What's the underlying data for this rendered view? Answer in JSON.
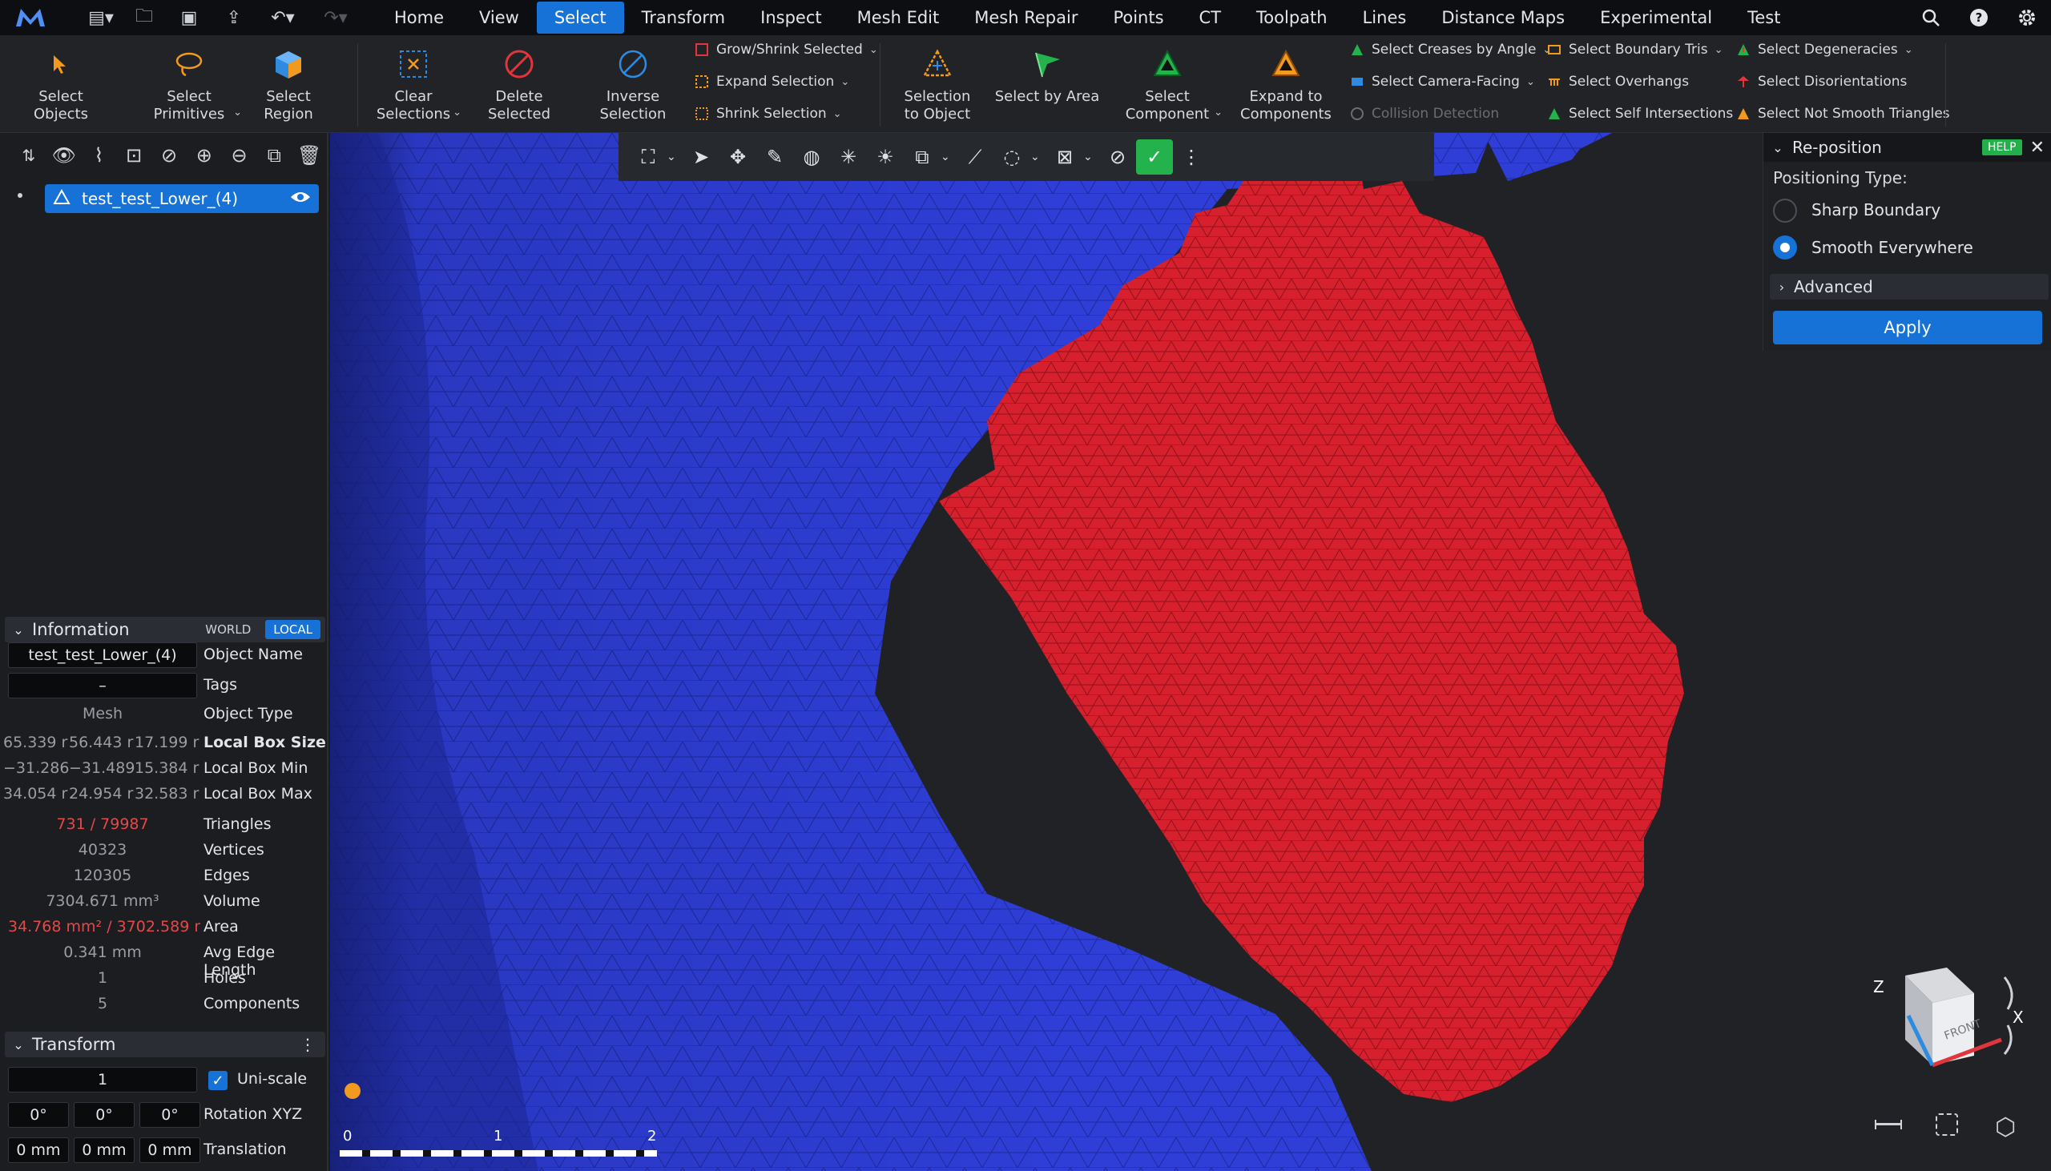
{
  "menu": {
    "tabs": [
      "Home",
      "View",
      "Select",
      "Transform",
      "Inspect",
      "Mesh Edit",
      "Mesh Repair",
      "Points",
      "CT",
      "Toolpath",
      "Lines",
      "Distance Maps",
      "Experimental",
      "Test"
    ],
    "active": "Select"
  },
  "ribbon": {
    "select_objects": "Select Objects",
    "select_primitives": "Select\nPrimitives",
    "select_region": "Select Region",
    "clear_selections": "Clear\nSelections",
    "delete_selected": "Delete Selected",
    "inverse_selection": "Inverse\nSelection",
    "grow_shrink": "Grow/Shrink Selected",
    "expand_selection": "Expand Selection",
    "shrink_selection": "Shrink Selection",
    "selection_to_object": "Selection\nto Object",
    "select_by_area": "Select by Area",
    "select_component": "Select\nComponent",
    "expand_to_components": "Expand to\nComponents",
    "select_creases": "Select Creases by Angle",
    "select_camera_facing": "Select Camera-Facing",
    "collision_detection": "Collision Detection",
    "select_boundary_tris": "Select Boundary Tris",
    "select_overhangs": "Select Overhangs",
    "select_self_intersections": "Select Self Intersections",
    "select_degeneracies": "Select Degeneracies",
    "select_disorientations": "Select Disorientations",
    "select_not_smooth": "Select Not Smooth Triangles"
  },
  "tree": {
    "object_name": "test_test_Lower_(4)"
  },
  "information": {
    "title": "Information",
    "world": "WORLD",
    "local": "LOCAL",
    "object_name_value": "test_test_Lower_(4)",
    "object_name_label": "Object Name",
    "tags_value": "–",
    "tags_label": "Tags",
    "object_type_value": "Mesh",
    "object_type_label": "Object Type",
    "box_size": [
      "65.339 r",
      "56.443 r",
      "17.199 r"
    ],
    "box_size_label": "Local Box Size",
    "box_min": [
      "−31.286",
      "−31.489",
      "15.384 r"
    ],
    "box_min_label": "Local Box Min",
    "box_max": [
      "34.054 r",
      "24.954 r",
      "32.583 r"
    ],
    "box_max_label": "Local Box Max",
    "triangles_value": "731 / 79987",
    "triangles_label": "Triangles",
    "vertices_value": "40323",
    "vertices_label": "Vertices",
    "edges_value": "120305",
    "edges_label": "Edges",
    "volume_value": "7304.671 mm³",
    "volume_label": "Volume",
    "area_value": "34.768 mm² / 3702.589 mr",
    "area_label": "Area",
    "avg_edge_value": "0.341 mm",
    "avg_edge_label": "Avg Edge Length",
    "holes_value": "1",
    "holes_label": "Holes",
    "components_value": "5",
    "components_label": "Components"
  },
  "transform": {
    "title": "Transform",
    "scale_value": "1",
    "uniscale_label": "Uni-scale",
    "rotation": [
      "0°",
      "0°",
      "0°"
    ],
    "rotation_label": "Rotation XYZ",
    "translation": [
      "0 mm",
      "0 mm",
      "0 mm"
    ],
    "translation_label": "Translation"
  },
  "reposition": {
    "title": "Re-position",
    "help": "HELP",
    "positioning_type_label": "Positioning Type:",
    "option_sharp": "Sharp Boundary",
    "option_smooth": "Smooth Everywhere",
    "selected": "Smooth Everywhere",
    "advanced": "Advanced",
    "apply": "Apply"
  },
  "scale_bar": {
    "ticks": [
      "0",
      "1",
      "2"
    ]
  },
  "view_cube": {
    "face": "FRONT",
    "axis_z": "Z",
    "axis_x": "X"
  },
  "colors": {
    "accent": "#1672d6",
    "mesh_blue": "#2b3fd0",
    "selection_red": "#d8222e",
    "active_green": "#23b24b"
  }
}
